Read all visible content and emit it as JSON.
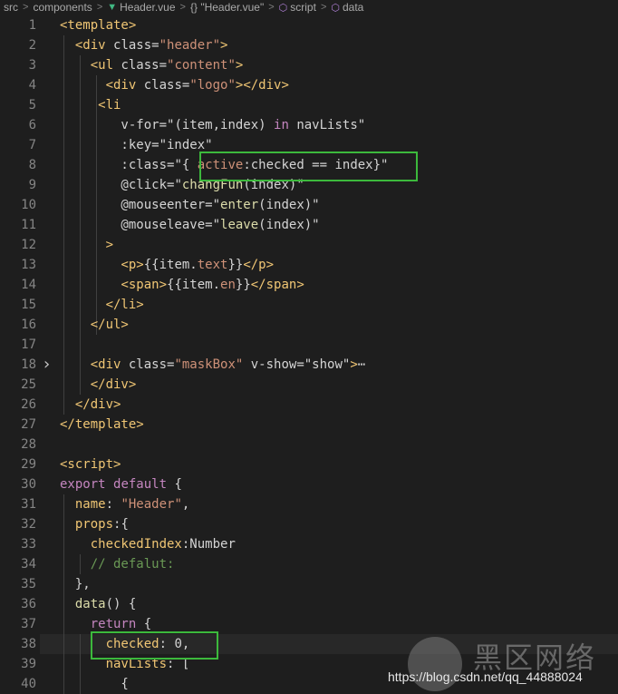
{
  "breadcrumb": {
    "items": [
      "src",
      "components",
      "Header.vue",
      "{} \"Header.vue\"",
      "script",
      "data"
    ]
  },
  "lines": [
    {
      "n": "1",
      "parts": [
        [
          "t-tag",
          "<template>"
        ]
      ]
    },
    {
      "n": "2",
      "parts": [
        [
          "t-plain",
          "  "
        ],
        [
          "t-tag",
          "<div "
        ],
        [
          "t-attr",
          "class="
        ],
        [
          "t-str",
          "\"header\""
        ],
        [
          "t-tag",
          ">"
        ]
      ]
    },
    {
      "n": "3",
      "parts": [
        [
          "t-plain",
          "    "
        ],
        [
          "t-tag",
          "<ul "
        ],
        [
          "t-attr",
          "class="
        ],
        [
          "t-str",
          "\"content\""
        ],
        [
          "t-tag",
          ">"
        ]
      ]
    },
    {
      "n": "4",
      "parts": [
        [
          "t-plain",
          "      "
        ],
        [
          "t-tag",
          "<div "
        ],
        [
          "t-attr",
          "class="
        ],
        [
          "t-str",
          "\"logo\""
        ],
        [
          "t-tag",
          "></div>"
        ]
      ]
    },
    {
      "n": "5",
      "parts": [
        [
          "t-plain",
          "     "
        ],
        [
          "t-tag",
          "<li"
        ]
      ]
    },
    {
      "n": "6",
      "parts": [
        [
          "t-plain",
          "        v-for="
        ],
        [
          "t-plain",
          "\"(item,index) "
        ],
        [
          "t-key",
          "in"
        ],
        [
          "t-plain",
          " navLists\""
        ]
      ]
    },
    {
      "n": "7",
      "parts": [
        [
          "t-plain",
          "        :key="
        ],
        [
          "t-plain",
          "\"index\""
        ]
      ]
    },
    {
      "n": "8",
      "parts": [
        [
          "t-plain",
          "        :class="
        ],
        [
          "t-plain",
          "\"{ "
        ],
        [
          "t-str",
          "active"
        ],
        [
          "t-plain",
          ":checked == index}\""
        ]
      ]
    },
    {
      "n": "9",
      "parts": [
        [
          "t-plain",
          "        @click="
        ],
        [
          "t-plain",
          "\""
        ],
        [
          "t-fn",
          "changFun"
        ],
        [
          "t-plain",
          "(index)\""
        ]
      ]
    },
    {
      "n": "10",
      "parts": [
        [
          "t-plain",
          "        @mouseenter="
        ],
        [
          "t-plain",
          "\""
        ],
        [
          "t-fn",
          "enter"
        ],
        [
          "t-plain",
          "(index)\""
        ]
      ]
    },
    {
      "n": "11",
      "parts": [
        [
          "t-plain",
          "        @mouseleave="
        ],
        [
          "t-plain",
          "\""
        ],
        [
          "t-fn",
          "leave"
        ],
        [
          "t-plain",
          "(index)\""
        ]
      ]
    },
    {
      "n": "12",
      "parts": [
        [
          "t-plain",
          "      "
        ],
        [
          "t-tag",
          ">"
        ]
      ]
    },
    {
      "n": "13",
      "parts": [
        [
          "t-plain",
          "        "
        ],
        [
          "t-tag",
          "<p>"
        ],
        [
          "t-plain",
          "{{item."
        ],
        [
          "t-str",
          "text"
        ],
        [
          "t-plain",
          "}}"
        ],
        [
          "t-tag",
          "</p>"
        ]
      ]
    },
    {
      "n": "14",
      "parts": [
        [
          "t-plain",
          "        "
        ],
        [
          "t-tag",
          "<span>"
        ],
        [
          "t-plain",
          "{{item."
        ],
        [
          "t-str",
          "en"
        ],
        [
          "t-plain",
          "}}"
        ],
        [
          "t-tag",
          "</span>"
        ]
      ]
    },
    {
      "n": "15",
      "parts": [
        [
          "t-plain",
          "      "
        ],
        [
          "t-tag",
          "</li>"
        ]
      ]
    },
    {
      "n": "16",
      "parts": [
        [
          "t-plain",
          "    "
        ],
        [
          "t-tag",
          "</ul>"
        ]
      ]
    },
    {
      "n": "17",
      "parts": []
    },
    {
      "n": "18",
      "parts": [
        [
          "t-plain",
          "    "
        ],
        [
          "t-tag",
          "<div "
        ],
        [
          "t-attr",
          "class="
        ],
        [
          "t-str",
          "\"maskBox\""
        ],
        [
          "t-plain",
          " v-show="
        ],
        [
          "t-plain",
          "\"show\""
        ],
        [
          "t-tag",
          ">"
        ],
        [
          "t-plain",
          "⋯"
        ]
      ]
    },
    {
      "n": "25",
      "parts": [
        [
          "t-plain",
          "    "
        ],
        [
          "t-tag",
          "</div>"
        ]
      ]
    },
    {
      "n": "26",
      "parts": [
        [
          "t-plain",
          "  "
        ],
        [
          "t-tag",
          "</div>"
        ]
      ]
    },
    {
      "n": "27",
      "parts": [
        [
          "t-tag",
          "</template>"
        ]
      ]
    },
    {
      "n": "28",
      "parts": []
    },
    {
      "n": "29",
      "parts": [
        [
          "t-tag",
          "<script>"
        ]
      ]
    },
    {
      "n": "30",
      "parts": [
        [
          "t-key",
          "export"
        ],
        [
          "t-plain",
          " "
        ],
        [
          "t-key",
          "default"
        ],
        [
          "t-plain",
          " {"
        ]
      ]
    },
    {
      "n": "31",
      "parts": [
        [
          "t-plain",
          "  "
        ],
        [
          "t-tag",
          "name"
        ],
        [
          "t-plain",
          ": "
        ],
        [
          "t-str",
          "\"Header\""
        ],
        [
          "t-plain",
          ","
        ]
      ]
    },
    {
      "n": "32",
      "parts": [
        [
          "t-plain",
          "  "
        ],
        [
          "t-tag",
          "props"
        ],
        [
          "t-plain",
          ":{"
        ]
      ]
    },
    {
      "n": "33",
      "parts": [
        [
          "t-plain",
          "    "
        ],
        [
          "t-tag",
          "checkedIndex"
        ],
        [
          "t-plain",
          ":Number"
        ]
      ]
    },
    {
      "n": "34",
      "parts": [
        [
          "t-plain",
          "    "
        ],
        [
          "t-comment",
          "// defalut:"
        ]
      ]
    },
    {
      "n": "35",
      "parts": [
        [
          "t-plain",
          "  },"
        ]
      ]
    },
    {
      "n": "36",
      "parts": [
        [
          "t-plain",
          "  "
        ],
        [
          "t-fn",
          "data"
        ],
        [
          "t-plain",
          "() {"
        ]
      ]
    },
    {
      "n": "37",
      "parts": [
        [
          "t-plain",
          "    "
        ],
        [
          "t-key",
          "return"
        ],
        [
          "t-plain",
          " {"
        ]
      ]
    },
    {
      "n": "38",
      "parts": [
        [
          "t-plain",
          "      "
        ],
        [
          "t-tag",
          "checked"
        ],
        [
          "t-plain",
          ": 0,"
        ]
      ]
    },
    {
      "n": "39",
      "parts": [
        [
          "t-plain",
          "      "
        ],
        [
          "t-tag",
          "navLists"
        ],
        [
          "t-plain",
          ": ["
        ]
      ]
    },
    {
      "n": "40",
      "parts": [
        [
          "t-plain",
          "        {"
        ]
      ]
    }
  ],
  "watermark": {
    "cn_text": "黑区网络",
    "url": "https://blog.csdn.net/qq_44888024"
  }
}
